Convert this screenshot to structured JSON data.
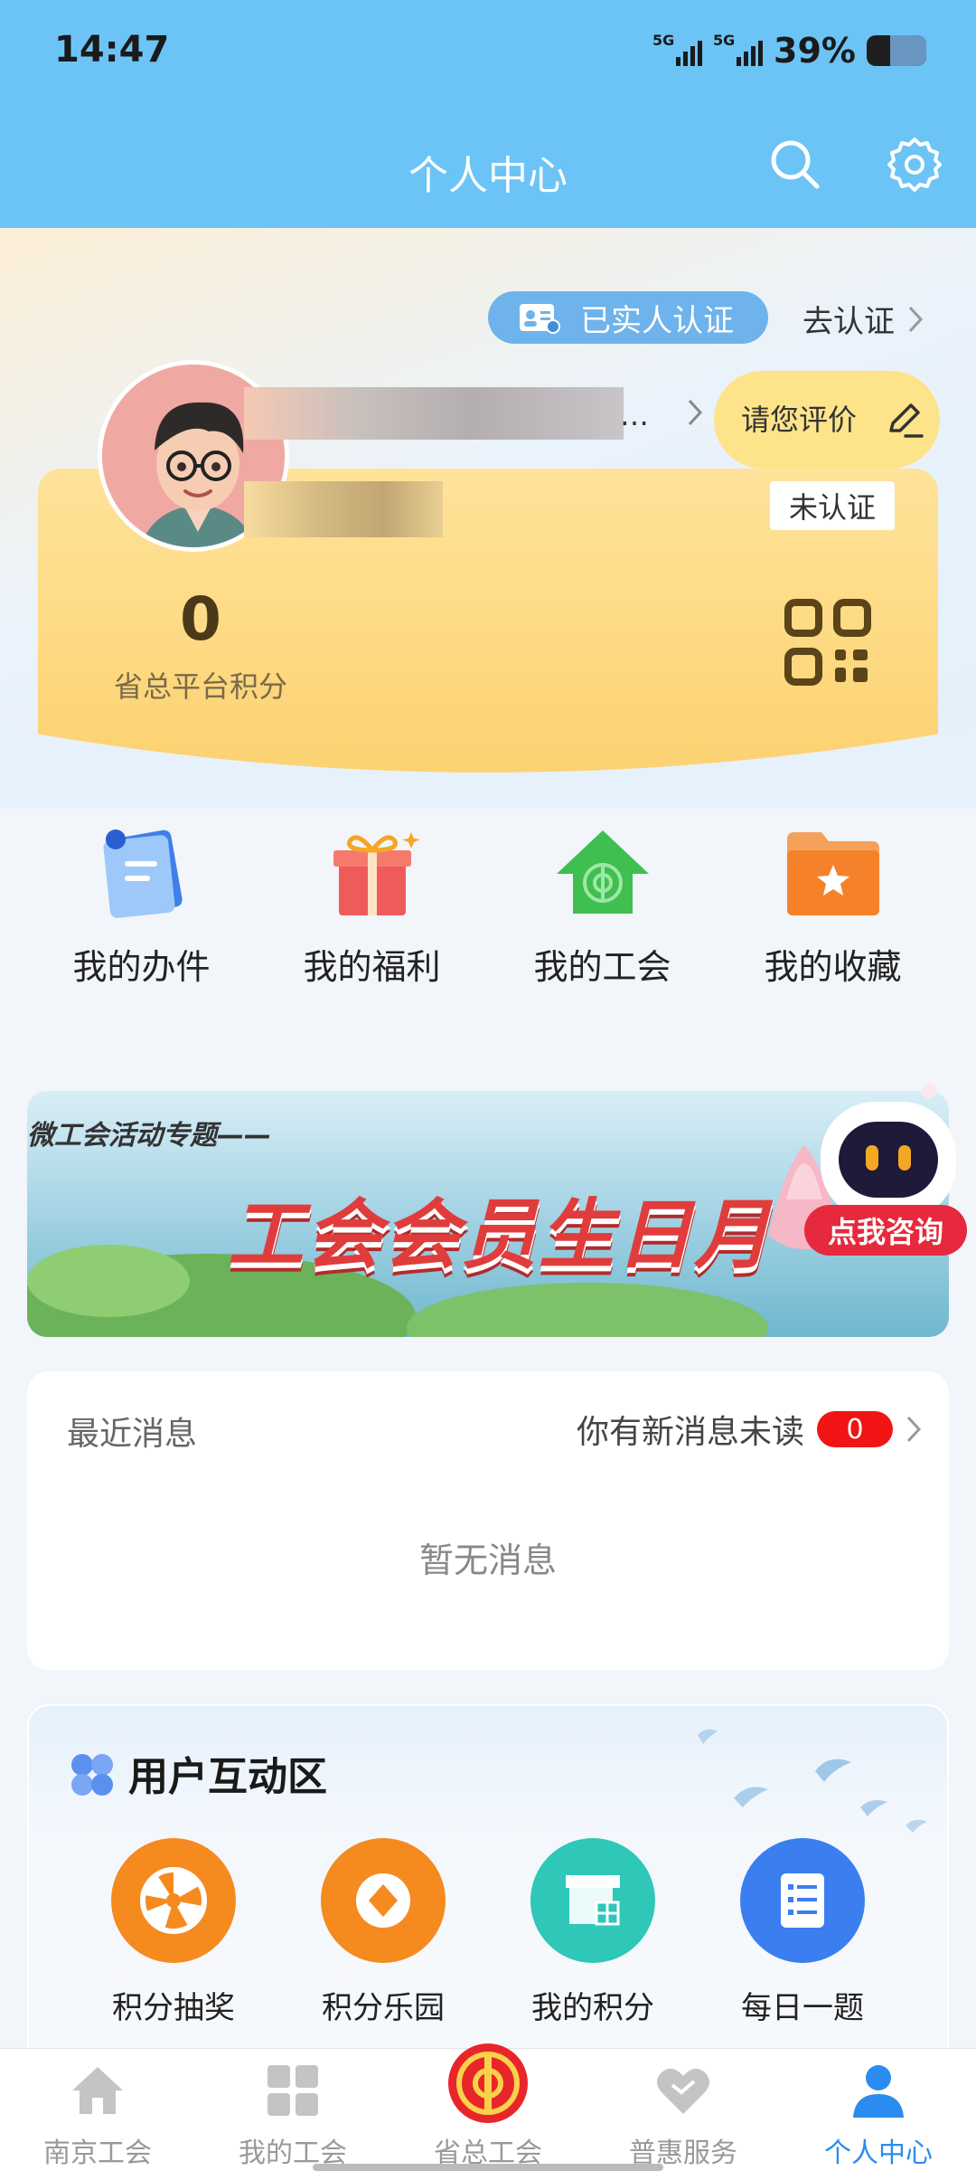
{
  "status": {
    "time": "14:47",
    "signal1": "5G",
    "signal2": "5G",
    "battery": "39%"
  },
  "header": {
    "title": "个人中心"
  },
  "profile": {
    "verified_label": "已实人认证",
    "go_verify": "去认证",
    "name_suffix": "…",
    "rate_label": "请您评价",
    "unverified_label": "未认证",
    "points_value": "0",
    "points_label": "省总平台积分"
  },
  "quick": [
    {
      "label": "我的办件",
      "icon": "document-icon"
    },
    {
      "label": "我的福利",
      "icon": "gift-icon"
    },
    {
      "label": "我的工会",
      "icon": "union-house-icon"
    },
    {
      "label": "我的收藏",
      "icon": "folder-star-icon"
    }
  ],
  "banner": {
    "subtitle": "微工会活动专题——",
    "title": "工会会员生日月",
    "consult": "点我咨询"
  },
  "messages": {
    "title": "最近消息",
    "unread_text": "你有新消息未读",
    "unread_count": "0",
    "empty": "暂无消息"
  },
  "interaction": {
    "title": "用户互动区",
    "items": [
      {
        "label": "积分抽奖",
        "icon": "wheel-icon",
        "color": "#f58a1f"
      },
      {
        "label": "积分乐园",
        "icon": "coin-icon",
        "color": "#f58a1f"
      },
      {
        "label": "我的积分",
        "icon": "store-icon",
        "color": "#2ec7b8"
      },
      {
        "label": "每日一题",
        "icon": "quiz-icon",
        "color": "#3b7ef0"
      }
    ]
  },
  "tabs": [
    {
      "label": "南京工会",
      "icon": "home-icon"
    },
    {
      "label": "我的工会",
      "icon": "grid-icon"
    },
    {
      "label": "省总工会",
      "icon": "union-emblem-icon"
    },
    {
      "label": "普惠服务",
      "icon": "heart-icon"
    },
    {
      "label": "个人中心",
      "icon": "person-icon",
      "active": true
    }
  ],
  "colors": {
    "header": "#6cc4f6",
    "active_tab": "#2b8cf0",
    "badge": "#f01414"
  }
}
